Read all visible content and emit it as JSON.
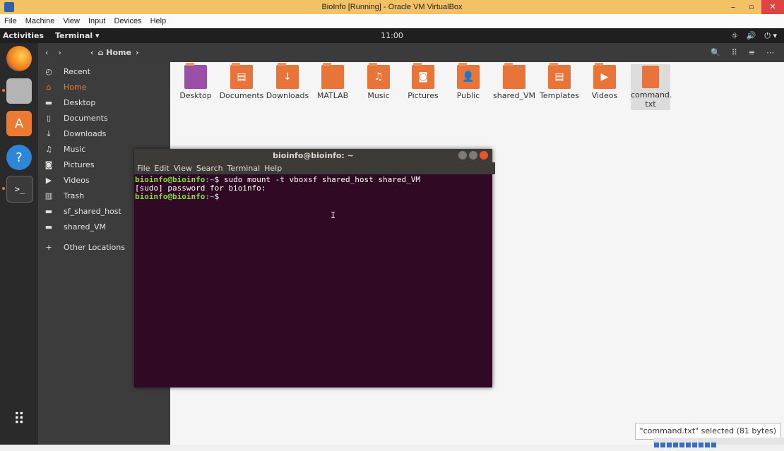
{
  "host_window": {
    "title": "BioInfo [Running] - Oracle VM VirtualBox",
    "minimize": "–",
    "maximize": "▫",
    "close": "✕",
    "menu": [
      "File",
      "Machine",
      "View",
      "Input",
      "Devices",
      "Help"
    ]
  },
  "ubuntu_topbar": {
    "activities": "Activities",
    "app_menu": "Terminal ▾",
    "clock": "11:00",
    "tray": [
      "⛗",
      "🔊",
      "⏻ ▾"
    ]
  },
  "dock": {
    "apps": [
      "firefox-icon",
      "files-icon",
      "software-icon",
      "help-icon",
      "terminal-icon",
      "show-apps-icon"
    ],
    "show_apps_glyph": "⠿",
    "terminal_glyph": ">_",
    "help_glyph": "?",
    "software_glyph": "A"
  },
  "nautilus": {
    "nav_back": "‹",
    "nav_forward": "›",
    "breadcrumb_left": "‹",
    "breadcrumb_home": "⌂ Home",
    "breadcrumb_right": "›",
    "tools": [
      "🔍",
      "⠿",
      "≡",
      "⋯"
    ],
    "sidebar": [
      {
        "icon": "◴",
        "label": "Recent"
      },
      {
        "icon": "⌂",
        "label": "Home"
      },
      {
        "icon": "▬",
        "label": "Desktop"
      },
      {
        "icon": "▯",
        "label": "Documents"
      },
      {
        "icon": "↓",
        "label": "Downloads"
      },
      {
        "icon": "♫",
        "label": "Music"
      },
      {
        "icon": "◙",
        "label": "Pictures"
      },
      {
        "icon": "▶",
        "label": "Videos"
      },
      {
        "icon": "▥",
        "label": "Trash"
      },
      {
        "icon": "▬",
        "label": "sf_shared_host"
      },
      {
        "icon": "▬",
        "label": "shared_VM"
      },
      {
        "icon": "+",
        "label": "Other Locations"
      }
    ],
    "folders": [
      {
        "label": "Desktop",
        "sym": ""
      },
      {
        "label": "Documents",
        "sym": "▤"
      },
      {
        "label": "Downloads",
        "sym": "↓"
      },
      {
        "label": "MATLAB",
        "sym": ""
      },
      {
        "label": "Music",
        "sym": "♫"
      },
      {
        "label": "Pictures",
        "sym": "◙"
      },
      {
        "label": "Public",
        "sym": "👤"
      },
      {
        "label": "shared_VM",
        "sym": ""
      },
      {
        "label": "Templates",
        "sym": "▤"
      },
      {
        "label": "Videos",
        "sym": "▶"
      }
    ],
    "file": {
      "label_line1": "command.",
      "label_line2": "txt"
    },
    "status": "\"command.txt\" selected (81 bytes)"
  },
  "terminal": {
    "title": "bioinfo@bioinfo: ~",
    "menu": [
      "File",
      "Edit",
      "View",
      "Search",
      "Terminal",
      "Help"
    ],
    "lines": [
      {
        "prompt": "bioinfo@bioinfo",
        "path": ":~",
        "text": "$ sudo mount -t vboxsf shared_host shared_VM"
      },
      {
        "prompt": "",
        "path": "",
        "text": "[sudo] password for bioinfo:"
      },
      {
        "prompt": "bioinfo@bioinfo",
        "path": ":~",
        "text": "$"
      }
    ],
    "ibeam": "I"
  }
}
